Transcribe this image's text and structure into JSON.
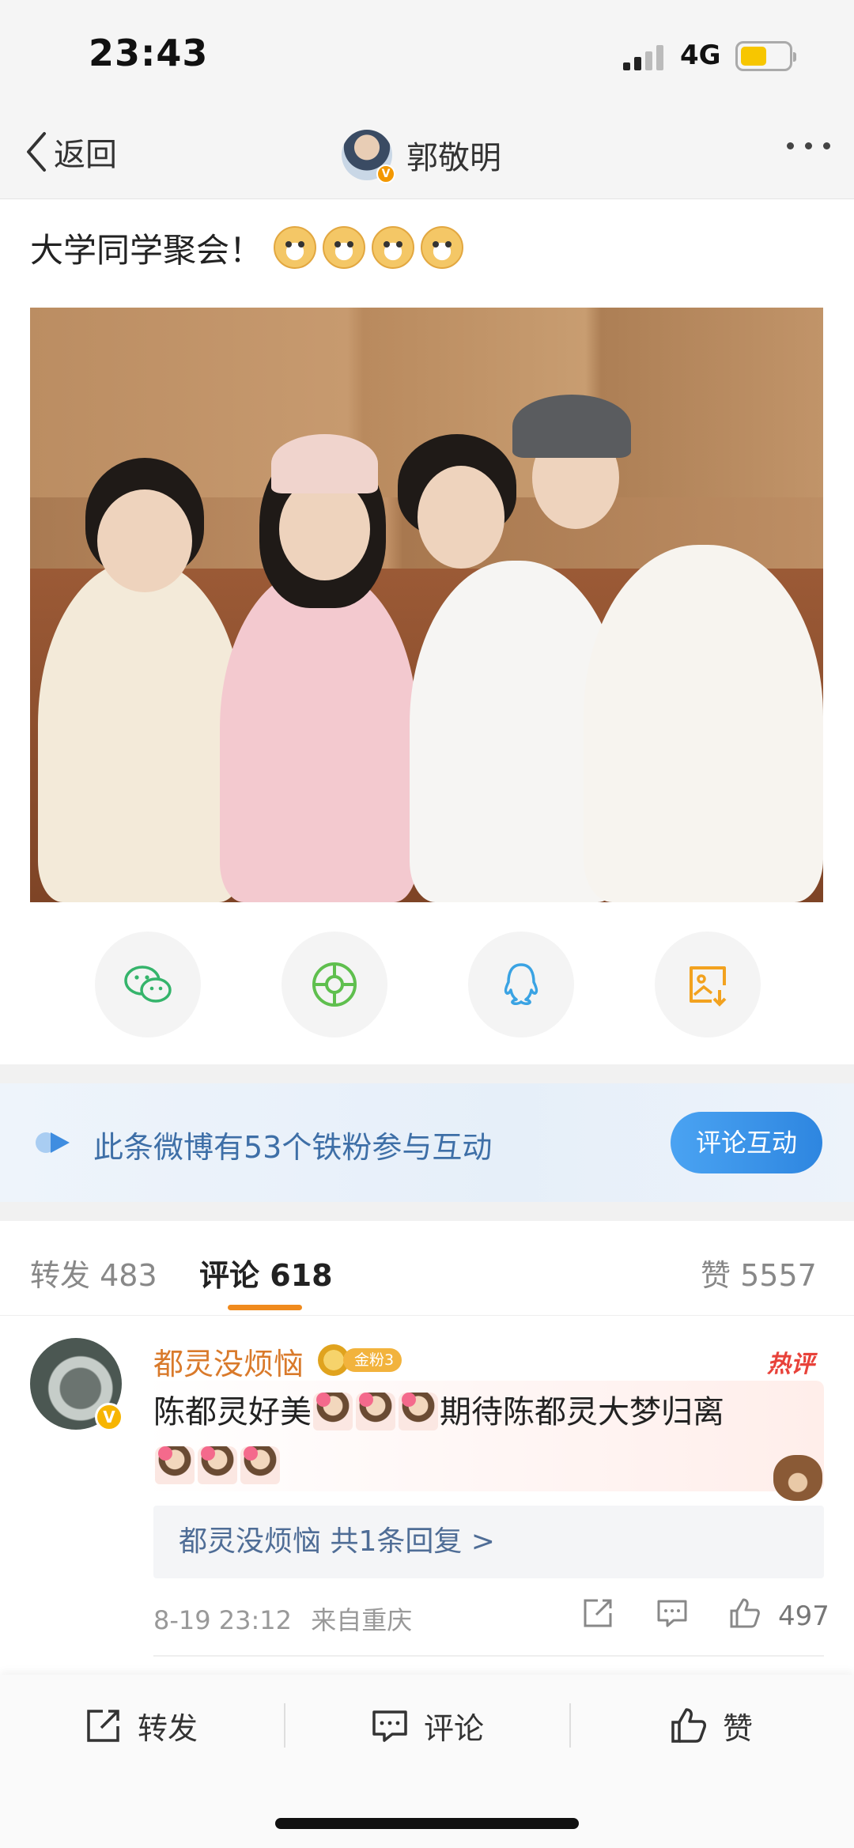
{
  "status": {
    "time": "23:43",
    "network": "4G",
    "battery_level": 0.55
  },
  "nav": {
    "back_label": "返回",
    "user_name": "郭敬明"
  },
  "post": {
    "text": "大学同学聚会！",
    "emoji_count": 4
  },
  "share": [
    "wechat-icon",
    "moments-icon",
    "qq-icon",
    "save-image-icon"
  ],
  "banner": {
    "text": "此条微博有53个铁粉参与互动",
    "button": "评论互动"
  },
  "tabs": {
    "repost_label": "转发",
    "repost_count": "483",
    "comment_label": "评论",
    "comment_count": "618",
    "like_label": "赞",
    "like_count": "5557"
  },
  "comment": {
    "user": "都灵没烦恼",
    "fan_badge": "金粉3",
    "hot_tag": "热评",
    "text_part1": "陈都灵好美",
    "text_part2": "期待陈都灵大梦归离",
    "replies": "都灵没烦恼  共1条回复 >",
    "date": "8-19 23:12",
    "location": "来自重庆",
    "likes": "497"
  },
  "toolbar": {
    "repost": "转发",
    "comment": "评论",
    "like": "赞"
  },
  "colors": {
    "accent_orange": "#f08a1d",
    "link_blue": "#4f6d96",
    "button_blue": "#2e86e0",
    "hot_red": "#e8423a"
  }
}
